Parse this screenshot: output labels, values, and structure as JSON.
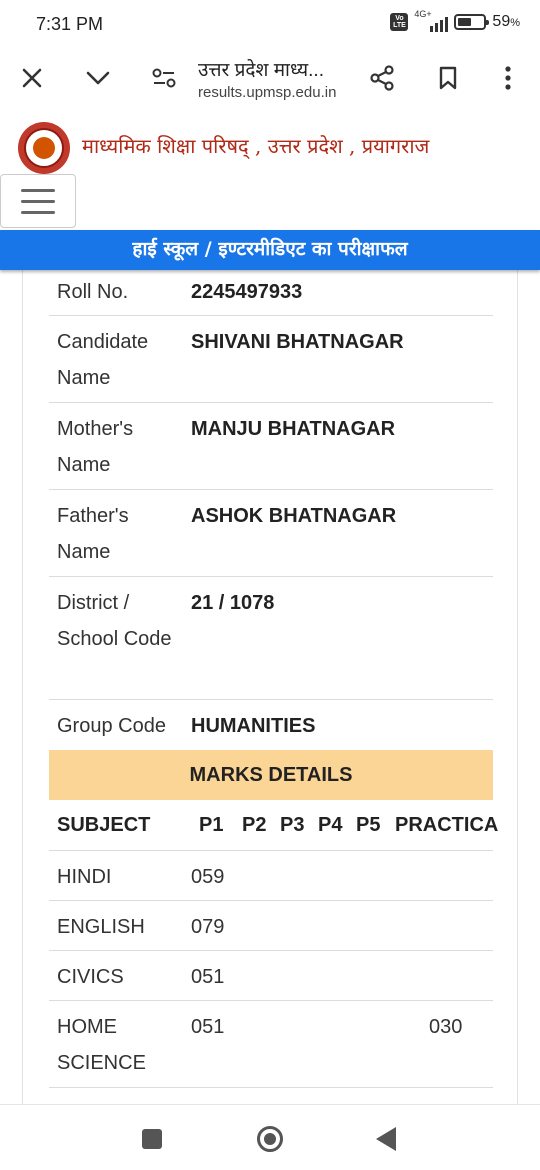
{
  "status_bar": {
    "time": "7:31 PM",
    "volte": "Vo LTE",
    "network": "4G+",
    "battery_level": 0.59,
    "battery_text": "59",
    "battery_unit": "%"
  },
  "browser": {
    "page_title": "उत्तर प्रदेश माध्य...",
    "url": "results.upmsp.edu.in",
    "icons": [
      "close-icon",
      "chevron-down-icon",
      "site-settings-icon",
      "share-icon",
      "bookmark-icon",
      "more-vert-icon"
    ]
  },
  "site": {
    "name": "माध्यमिक शिक्षा परिषद् , उत्तर प्रदेश , प्रयागराज",
    "banner": "हाई स्कूल / इण्टरमीडिएट का परीक्षाफल"
  },
  "details": [
    {
      "label": "Roll No.",
      "value": "2245497933"
    },
    {
      "label": "Candidate Name",
      "value": "SHIVANI BHATNAGAR"
    },
    {
      "label": "Mother's Name",
      "value": "MANJU BHATNAGAR"
    },
    {
      "label": "Father's Name",
      "value": "ASHOK BHATNAGAR"
    },
    {
      "label": "District / School Code",
      "value": "21 / 1078"
    },
    {
      "label": "Group Code",
      "value": "HUMANITIES"
    }
  ],
  "marks": {
    "heading": "MARKS DETAILS",
    "columns": [
      "SUBJECT",
      "P1",
      "P2",
      "P3",
      "P4",
      "P5",
      "PRACTICA"
    ],
    "rows": [
      {
        "subject": "HINDI",
        "p1": "059",
        "practical": ""
      },
      {
        "subject": "ENGLISH",
        "p1": "079",
        "practical": ""
      },
      {
        "subject": "CIVICS",
        "p1": "051",
        "practical": ""
      },
      {
        "subject": "HOME SCIENCE",
        "p1": "051",
        "practical": "030"
      }
    ]
  },
  "colors": {
    "banner": "#1976e8",
    "marks_header": "#fbd596",
    "site_name": "#b02a17"
  }
}
